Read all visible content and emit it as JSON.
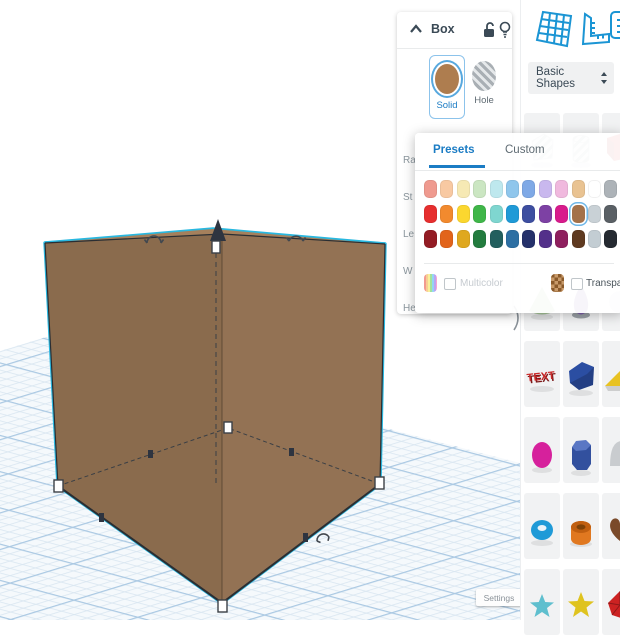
{
  "viewport": {
    "settings_label": "Settings",
    "selection_color": "#29B8E0",
    "box_left_face": "#8A6B4D",
    "box_right_face": "#937254",
    "box_top_face": "#A5805C",
    "grid_major_line": "#ABC9E3",
    "grid_minor_line": "#D9E6F1"
  },
  "inspector": {
    "title": "Box",
    "solid_label": "Solid",
    "hole_label": "Hole",
    "solid_color": "#AE7D4F",
    "property_labels": [
      "Ra",
      "St",
      "Le",
      "W",
      "He"
    ],
    "icons": [
      "collapse-chevron-icon",
      "lock-icon",
      "lightbulb-icon"
    ]
  },
  "color_picker": {
    "tabs": [
      {
        "label": "Presets",
        "active": true
      },
      {
        "label": "Custom",
        "active": false
      }
    ],
    "multicolor_label": "Multicolor",
    "transparent_label": "Transparent",
    "selected": {
      "row": 1,
      "col": 9,
      "color": "#A3714A"
    },
    "rows": [
      [
        "#EF9A8F",
        "#F8C9A2",
        "#F6E9B4",
        "#CBE6C2",
        "#BEE8EE",
        "#8FC6EC",
        "#7FA9E6",
        "#C9B8EE",
        "#F0B9DE",
        "#E9C392",
        "#FFFFFF",
        "#ADB3B8"
      ],
      [
        "#E62E2E",
        "#F28A2E",
        "#FBD72F",
        "#3FB649",
        "#7FD6D0",
        "#1F9AD7",
        "#3D4EA0",
        "#7D41A4",
        "#D81B8C",
        "#A3714A",
        "#C9D1D6",
        "#5A6065"
      ],
      [
        "#931C24",
        "#E2641B",
        "#DFA81F",
        "#237C3F",
        "#225F5E",
        "#2D6FA3",
        "#25316B",
        "#53308A",
        "#8E1F5E",
        "#5F3A20",
        "#C3CDD3",
        "#252A31"
      ]
    ]
  },
  "sidebar": {
    "category_value": "Basic Shapes",
    "toolbar_icons": [
      "workplane-icon",
      "ruler-icon",
      "notes-icon"
    ],
    "text_shape_label": "TEXT",
    "shapes": [
      {
        "name": "hole-box",
        "color": "#ECEFF1"
      },
      {
        "name": "hole-cylinder",
        "color": "#ECEFF1"
      },
      {
        "name": "red-box",
        "color": "#D42A2A"
      },
      {
        "name": "green-cone",
        "color": "#A9C79B"
      },
      {
        "name": "purple-droplet",
        "color": "#7C5FA8"
      },
      {
        "name": "gray-sphere",
        "color": "#DADDE0"
      },
      {
        "name": "text",
        "color": "#C92A2A"
      },
      {
        "name": "blue-roof",
        "color": "#2B4EA2"
      },
      {
        "name": "yellow-wedge",
        "color": "#E8C222"
      },
      {
        "name": "pink-egg",
        "color": "#D6219C"
      },
      {
        "name": "blue-polygon",
        "color": "#32509E"
      },
      {
        "name": "gray-round",
        "color": "#C9CCCF"
      },
      {
        "name": "blue-torus",
        "color": "#1F9AD7"
      },
      {
        "name": "orange-tube",
        "color": "#E07820"
      },
      {
        "name": "brown-heart",
        "color": "#7A4A2A"
      },
      {
        "name": "teal-star",
        "color": "#5FBFCE"
      },
      {
        "name": "yellow-star",
        "color": "#DFC31F"
      },
      {
        "name": "red-icosahedron",
        "color": "#CC2222"
      }
    ]
  }
}
